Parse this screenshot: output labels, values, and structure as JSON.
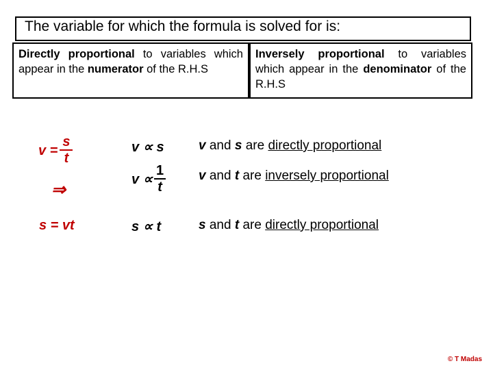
{
  "slide": {
    "title": "The variable for which the formula is solved for is:",
    "headers": {
      "left_bold_1": "Directly",
      "left_bold_2": "proportional",
      "left_plain_1": "to",
      "left_plain_2": "variables which appear in the",
      "left_bold_3": "numerator",
      "left_plain_3": "of the R.H.S",
      "right_bold_1": "Inversely",
      "right_bold_2": "proportional",
      "right_plain_1": "to",
      "right_plain_2": "variables which appear in the",
      "right_bold_3": "denominator",
      "right_plain_3": "of the R.H.S"
    },
    "equations": {
      "formula_lead": "v =",
      "formula_numerator": "s",
      "formula_denominator": "t",
      "implies_symbol": "⇒",
      "second_formula": "s = vt"
    },
    "proportions": {
      "p1_left": "v",
      "p1_symbol": "∝",
      "p1_right": "s",
      "p2_left": "v",
      "p2_symbol": "∝",
      "p2_num": "1",
      "p2_den": "t",
      "p3_left": "s",
      "p3_symbol": "∝",
      "p3_right": "t"
    },
    "statements": [
      {
        "var1": "v",
        "and": "and",
        "var2": "s",
        "are": "are",
        "relation": "directly proportional"
      },
      {
        "var1": "v",
        "and": "and",
        "var2": "t",
        "are": "are",
        "relation": "inversely proportional"
      },
      {
        "var1": "s",
        "and": "and",
        "var2": "t",
        "are": "are",
        "relation": "directly proportional"
      }
    ],
    "credit": "© T Madas",
    "colors": {
      "accent_red": "#c00000",
      "text_black": "#000000",
      "background": "#ffffff"
    }
  }
}
